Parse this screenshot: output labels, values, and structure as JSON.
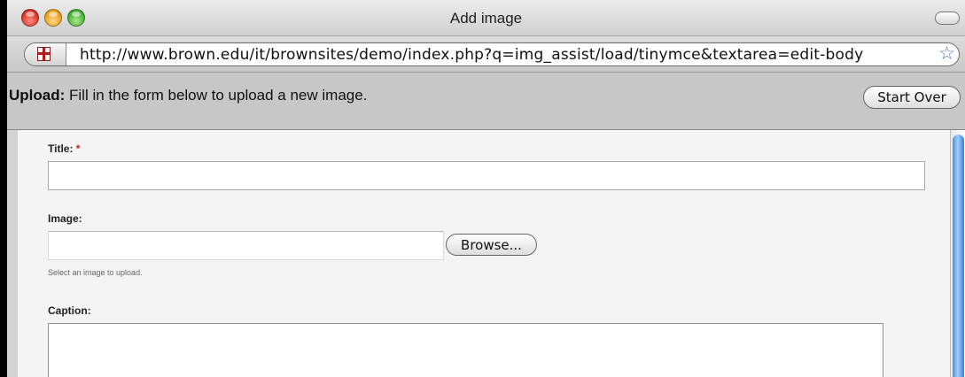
{
  "window": {
    "title": "Add image",
    "url": "http://www.brown.edu/it/brownsites/demo/index.php?q=img_assist/load/tinymce&textarea=edit-body"
  },
  "upload_bar": {
    "prefix": "Upload:",
    "message": "Fill in the form below to upload a new image.",
    "start_over_label": "Start Over"
  },
  "form": {
    "title": {
      "label": "Title:",
      "required_mark": "*",
      "value": ""
    },
    "image": {
      "label": "Image:",
      "browse_label": "Browse...",
      "description": "Select an image to upload.",
      "value": ""
    },
    "caption": {
      "label": "Caption:",
      "value": ""
    }
  },
  "icons": {
    "site_icon": "brown-shield-icon",
    "bookmark_icon": "star-icon"
  },
  "colors": {
    "required": "#cc2020",
    "scroll_thumb": "#4b8fdb",
    "shield_red": "#b31b1b"
  }
}
